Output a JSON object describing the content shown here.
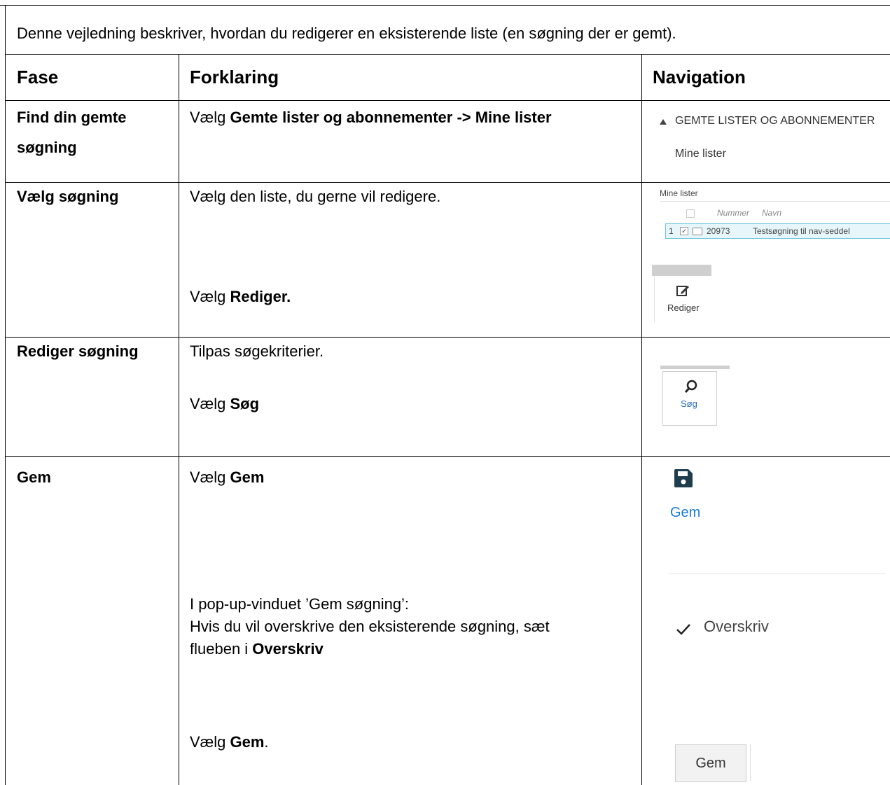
{
  "intro": "Denne vejledning beskriver, hvordan du redigerer en eksisterende liste (en søgning der er gemt).",
  "headers": {
    "fase": "Fase",
    "forklaring": "Forklaring",
    "navigation": "Navigation"
  },
  "row1": {
    "fase_line1": "Find din gemte",
    "fase_line2": "søgning",
    "expl_prefix": "Vælg ",
    "expl_bold": "Gemte lister og abonnementer -> Mine lister",
    "nav_section": "GEMTE LISTER OG ABONNEMENTER",
    "nav_item": "Mine lister"
  },
  "row2": {
    "fase": "Vælg søgning",
    "expl1": "Vælg den liste, du gerne vil redigere.",
    "expl2_prefix": "Vælg ",
    "expl2_bold": "Rediger.",
    "mini_title": "Mine lister",
    "col_nummer": "Nummer",
    "col_navn": "Navn",
    "row_index": "1",
    "row_nummer": "20973",
    "row_navn": "Testsøgning til nav-seddel",
    "btn_label": "Rediger"
  },
  "row3": {
    "fase": "Rediger søgning",
    "expl1": "Tilpas søgekriterier.",
    "expl2_prefix": "Vælg ",
    "expl2_bold": "Søg",
    "btn_label": "Søg"
  },
  "row4": {
    "fase": "Gem",
    "expl1_prefix": "Vælg ",
    "expl1_bold": "Gem",
    "popup_line1": "I pop-up-vinduet ’Gem søgning’:",
    "popup_line2": "Hvis du vil overskrive den eksisterende søgning, sæt",
    "popup_line3_prefix": "flueben i ",
    "popup_line3_bold": "Overskriv",
    "expl3_prefix": "Vælg ",
    "expl3_bold": "Gem",
    "expl3_suffix": ".",
    "gem_icon_label": "Gem",
    "overskriv_label": "Overskriv",
    "gem_button_label": "Gem"
  }
}
